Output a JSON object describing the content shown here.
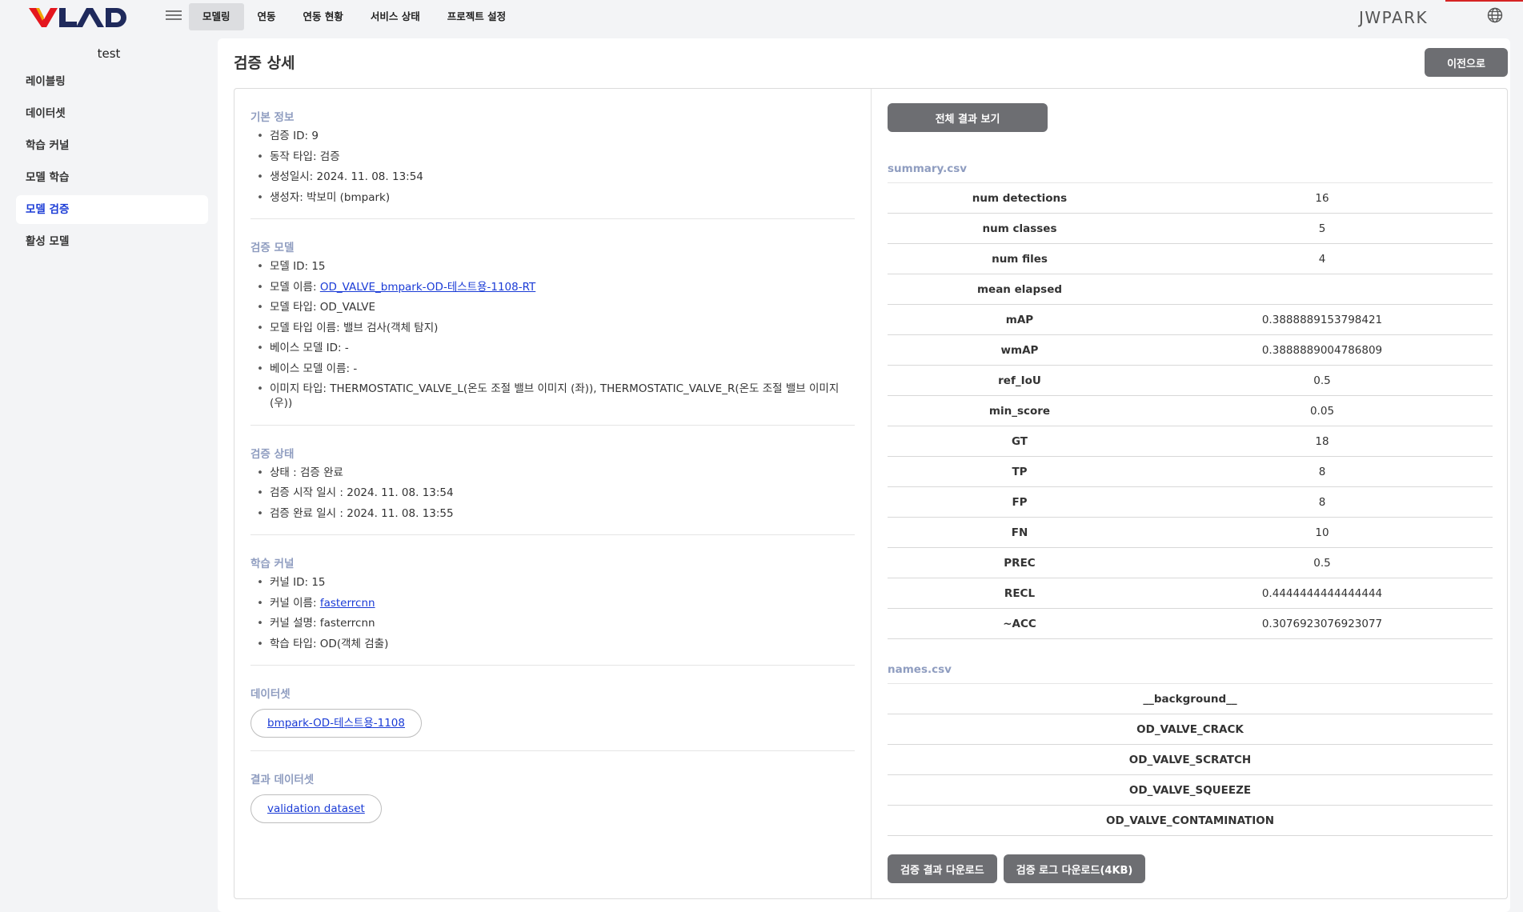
{
  "header": {
    "logo_text": "VLAD",
    "nav": [
      "모델링",
      "연동",
      "연동 현황",
      "서비스 상태",
      "프로젝트 설정"
    ],
    "username": "JWPARK"
  },
  "sidebar": {
    "project": "test",
    "items": [
      "레이블링",
      "데이터셋",
      "학습 커널",
      "모델 학습",
      "모델 검증",
      "활성 모델"
    ]
  },
  "page": {
    "title": "검증 상세",
    "back_label": "이전으로"
  },
  "basic_info": {
    "title": "기본 정보",
    "items": [
      "검증 ID: 9",
      "동작 타입: 검증",
      "생성일시: 2024. 11. 08. 13:54",
      "생성자: 박보미 (bmpark)"
    ]
  },
  "model": {
    "title": "검증 모델",
    "id": "모델 ID: 15",
    "name_label": "모델 이름: ",
    "name_link": "OD_VALVE_bmpark-OD-테스트용-1108-RT",
    "type": "모델 타입: OD_VALVE",
    "type_name": "모델 타입 이름: 밸브 검사(객체 탐지)",
    "base_id": "베이스 모델 ID: -",
    "base_name": "베이스 모델 이름: -",
    "image_type": "이미지 타입: THERMOSTATIC_VALVE_L(온도 조절 밸브 이미지 (좌)), THERMOSTATIC_VALVE_R(온도 조절 밸브 이미지 (우))"
  },
  "status": {
    "title": "검증 상태",
    "items": [
      "상태 : 검증 완료",
      "검증 시작 일시 : 2024. 11. 08. 13:54",
      "검증 완료 일시 : 2024. 11. 08. 13:55"
    ]
  },
  "kernel": {
    "title": "학습 커널",
    "id": "커널 ID: 15",
    "name_label": "커널 이름: ",
    "name_link": "fasterrcnn",
    "desc": "커널 설명: fasterrcnn",
    "type": "학습 타입: OD(객체 검출)"
  },
  "dataset": {
    "title": "데이터셋",
    "link": "bmpark-OD-테스트용-1108"
  },
  "result_dataset": {
    "title": "결과 데이터셋",
    "link": "validation dataset"
  },
  "results": {
    "view_all_label": "전체 결과 보기",
    "summary_title": "summary.csv",
    "summary": [
      {
        "key": "num detections",
        "value": "16"
      },
      {
        "key": "num classes",
        "value": "5"
      },
      {
        "key": "num files",
        "value": "4"
      },
      {
        "key": "mean elapsed",
        "value": ""
      },
      {
        "key": "mAP",
        "value": "0.3888889153798421"
      },
      {
        "key": "wmAP",
        "value": "0.3888889004786809"
      },
      {
        "key": "ref_IoU",
        "value": "0.5"
      },
      {
        "key": "min_score",
        "value": "0.05"
      },
      {
        "key": "GT",
        "value": "18"
      },
      {
        "key": "TP",
        "value": "8"
      },
      {
        "key": "FP",
        "value": "8"
      },
      {
        "key": "FN",
        "value": "10"
      },
      {
        "key": "PREC",
        "value": "0.5"
      },
      {
        "key": "RECL",
        "value": "0.4444444444444444"
      },
      {
        "key": "~ACC",
        "value": "0.3076923076923077"
      }
    ],
    "names_title": "names.csv",
    "names": [
      "__background__",
      "OD_VALVE_CRACK",
      "OD_VALVE_SCRATCH",
      "OD_VALVE_SQUEEZE",
      "OD_VALVE_CONTAMINATION"
    ],
    "download_result_label": "검증 결과 다운로드",
    "download_log_label": "검증 로그 다운로드(4KB)"
  },
  "colors": {
    "accent": "#1a3bd6",
    "section_title": "#8f9dc0",
    "button": "#6d6e72",
    "logo_red": "#e4161e",
    "logo_navy": "#1f2a5c"
  }
}
